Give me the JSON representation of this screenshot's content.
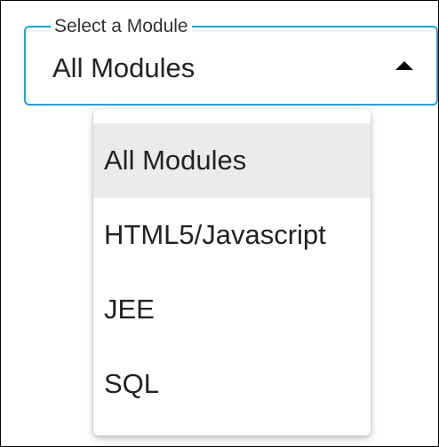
{
  "select": {
    "label": "Select a Module",
    "value": "All Modules",
    "accent_color": "#1aa3e8",
    "caret_icon": "caret-up-icon"
  },
  "menu": {
    "selected_index": 0,
    "items": [
      {
        "label": "All Modules"
      },
      {
        "label": "HTML5/Javascript"
      },
      {
        "label": "JEE"
      },
      {
        "label": "SQL"
      }
    ]
  }
}
